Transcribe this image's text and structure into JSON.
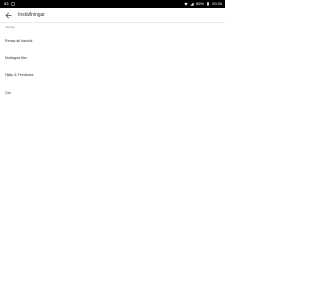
{
  "status_bar": {
    "left_text": "83",
    "battery_percent": "66%",
    "time": "20:30",
    "icons": [
      "notification-icon",
      "wifi-icon",
      "signal-icon",
      "battery-icon"
    ]
  },
  "app_bar": {
    "title": "Inställningar",
    "back_icon": "arrow-back-icon"
  },
  "settings": {
    "section_header": "Vanliga",
    "items": [
      {
        "label": "Rensa all historik"
      },
      {
        "label": "Mottagna filer"
      },
      {
        "label": "Hjälp & Feedback"
      },
      {
        "label": "Om"
      }
    ]
  },
  "colors": {
    "status_bar_bg": "#000000",
    "background": "#ffffff",
    "text_primary": "#333333",
    "text_secondary": "#8a8a8a"
  }
}
